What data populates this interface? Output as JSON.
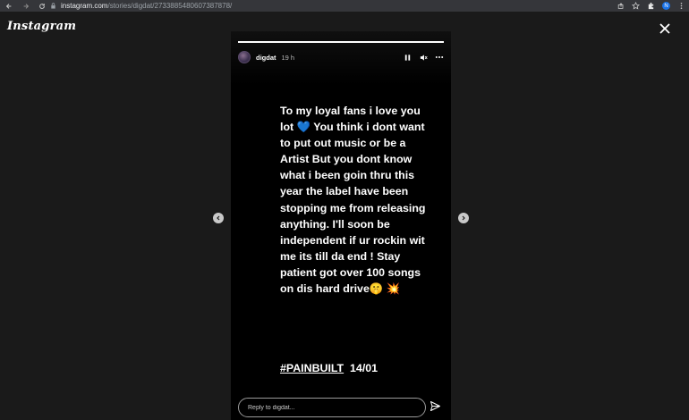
{
  "browser": {
    "url_host": "instagram.com",
    "url_path": "/stories/digdat/2733885480607387878/",
    "profile_initial": "N",
    "icons": [
      "back-icon",
      "forward-icon",
      "reload-icon",
      "lock-icon",
      "share-icon",
      "star-icon",
      "extensions-icon",
      "menu-icon"
    ]
  },
  "app": {
    "logo": "Instagram"
  },
  "story": {
    "username": "digdat",
    "time": "19 h",
    "progress": 1.0,
    "text": "To my loyal fans i love you lot 💙 You think i dont want to put out music or be a Artist But you dont know what i been goin thru this year the label have been stopping me from releasing anything. I'll soon be independent if ur rockin wit me its till da end ! Stay patient got over 100 songs on dis hard drive🤫 💥",
    "hashtag": "#PAINBUILT",
    "date": "14/01",
    "reply_placeholder": "Reply to digdat..."
  },
  "colors": {
    "background": "#1a1a1a",
    "story_bg": "#000000",
    "chrome_bg": "#35363a",
    "text": "#ffffff"
  }
}
